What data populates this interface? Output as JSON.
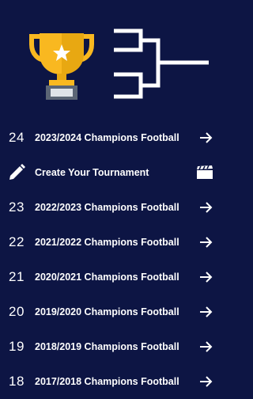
{
  "header": {
    "trophy_icon": "trophy-icon",
    "bracket_icon": "tournament-bracket-icon",
    "colors": {
      "trophy_gold": "#f9b820",
      "trophy_base": "#5b6575",
      "background": "#0d1544"
    }
  },
  "menu": [
    {
      "number": "24",
      "label": "2023/2024 Champions Football",
      "trailing_icon": "arrow-right-icon"
    },
    {
      "icon": "pencil-icon",
      "label": "Create Your Tournament",
      "trailing_icon": "clapperboard-icon"
    },
    {
      "number": "23",
      "label": "2022/2023 Champions Football",
      "trailing_icon": "arrow-right-icon"
    },
    {
      "number": "22",
      "label": "2021/2022 Champions Football",
      "trailing_icon": "arrow-right-icon"
    },
    {
      "number": "21",
      "label": "2020/2021 Champions Football",
      "trailing_icon": "arrow-right-icon"
    },
    {
      "number": "20",
      "label": "2019/2020 Champions Football",
      "trailing_icon": "arrow-right-icon"
    },
    {
      "number": "19",
      "label": "2018/2019 Champions Football",
      "trailing_icon": "arrow-right-icon"
    },
    {
      "number": "18",
      "label": "2017/2018 Champions Football",
      "trailing_icon": "arrow-right-icon"
    }
  ]
}
